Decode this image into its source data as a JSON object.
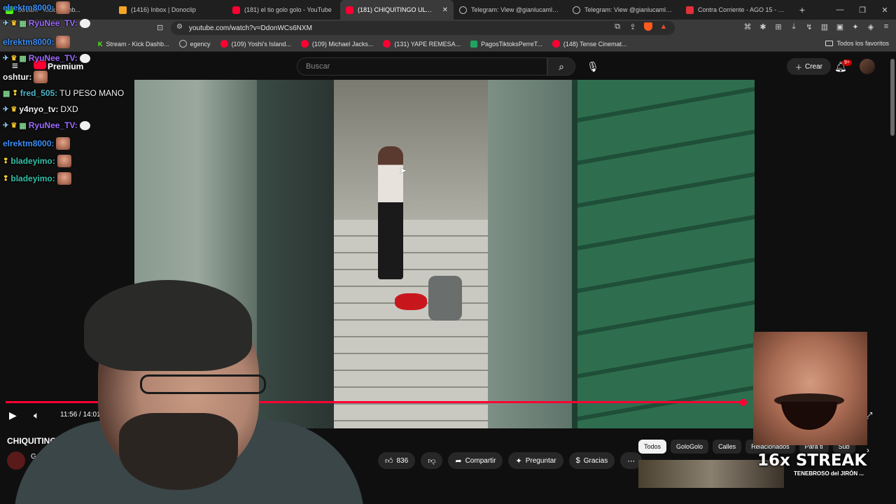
{
  "browser": {
    "tabs": [
      {
        "label": "Stream - Kick Dashb...",
        "icon": "kick-icon"
      },
      {
        "label": "(1416) Inbox | Donoclip",
        "icon": "donoclip-icon"
      },
      {
        "label": "(181) el tio golo golo - YouTube",
        "icon": "youtube-icon"
      },
      {
        "label": "(181) CHIQUITINGO ULTRA BAR...",
        "icon": "youtube-icon",
        "active": true
      },
      {
        "label": "Telegram: View @gianlucamldsarchi...",
        "icon": "telegram-icon"
      },
      {
        "label": "Telegram: View @gianlucamldsarchi...",
        "icon": "telegram-icon"
      },
      {
        "label": "Contra Corriente - AGO 15 - EL ACO...",
        "icon": "page-icon"
      }
    ],
    "new_tab": "+",
    "url": "youtube.com/watch?v=DdonWCs6NXM",
    "bookmarks": [
      {
        "label": "Stream - Kick Dashb...",
        "icon": "kick-icon"
      },
      {
        "label": "egency",
        "icon": "page-icon"
      },
      {
        "label": "(109) Yoshi's Island...",
        "icon": "youtube-icon"
      },
      {
        "label": "(109) Michael Jacks...",
        "icon": "youtube-icon"
      },
      {
        "label": "(131) YAPE REMESA...",
        "icon": "youtube-icon"
      },
      {
        "label": "PagosTiktoksPerreT...",
        "icon": "sheets-icon"
      },
      {
        "label": "(148) Tense Cinemat...",
        "icon": "youtube-icon"
      }
    ],
    "all_bookmarks": "Todos los favoritos"
  },
  "youtube": {
    "logo_text": "Premium",
    "search_placeholder": "Buscar",
    "create_label": "Crear",
    "notif_count": "9+",
    "time": "11:56 / 14:01",
    "progress": 0.85,
    "title": "CHIQUITINGO",
    "channel": "Gol",
    "likes": "836",
    "share": "Compartir",
    "ask": "Preguntar",
    "thanks": "Gracias",
    "chips": [
      "Todos",
      "GoloGolo",
      "Calles",
      "Relacionados",
      "Para ti",
      "Sub"
    ],
    "rec_title": "TENEBROSO del JIRÓN ..."
  },
  "chat": [
    {
      "user": "elrektm8000:",
      "text": "",
      "emote": "face",
      "color": "blue",
      "badges": []
    },
    {
      "user": "RyuNee_TV:",
      "text": "",
      "emote": "bubble",
      "color": "purple",
      "badges": [
        "sword",
        "crown",
        "grid"
      ]
    },
    {
      "user": "elrektm8000:",
      "text": "",
      "emote": "face",
      "color": "blue",
      "badges": []
    },
    {
      "user": "RyuNee_TV:",
      "text": "",
      "emote": "bubble",
      "color": "purple",
      "badges": [
        "sword",
        "crown",
        "grid"
      ]
    },
    {
      "user": "oshtur:",
      "text": "",
      "emote": "face",
      "color": "white",
      "badges": []
    },
    {
      "user": "fred_505:",
      "text": "TU PESO MANO",
      "emote": "",
      "color": "cyan",
      "badges": [
        "grid",
        "bulb"
      ]
    },
    {
      "user": "y4nyo_tv:",
      "text": "DXD",
      "emote": "",
      "color": "white",
      "badges": [
        "sword",
        "crown"
      ]
    },
    {
      "user": "RyuNee_TV:",
      "text": "",
      "emote": "bubble",
      "color": "purple",
      "badges": [
        "sword",
        "crown",
        "grid"
      ]
    },
    {
      "user": "elrektm8000:",
      "text": "",
      "emote": "face",
      "color": "blue",
      "badges": []
    },
    {
      "user": "bladeyimo:",
      "text": "",
      "emote": "face",
      "color": "teal",
      "badges": [
        "bulb"
      ]
    },
    {
      "user": "bladeyimo:",
      "text": "",
      "emote": "face",
      "color": "teal",
      "badges": [
        "bulb"
      ]
    }
  ],
  "overlay": {
    "streak": "16x STREAK"
  }
}
